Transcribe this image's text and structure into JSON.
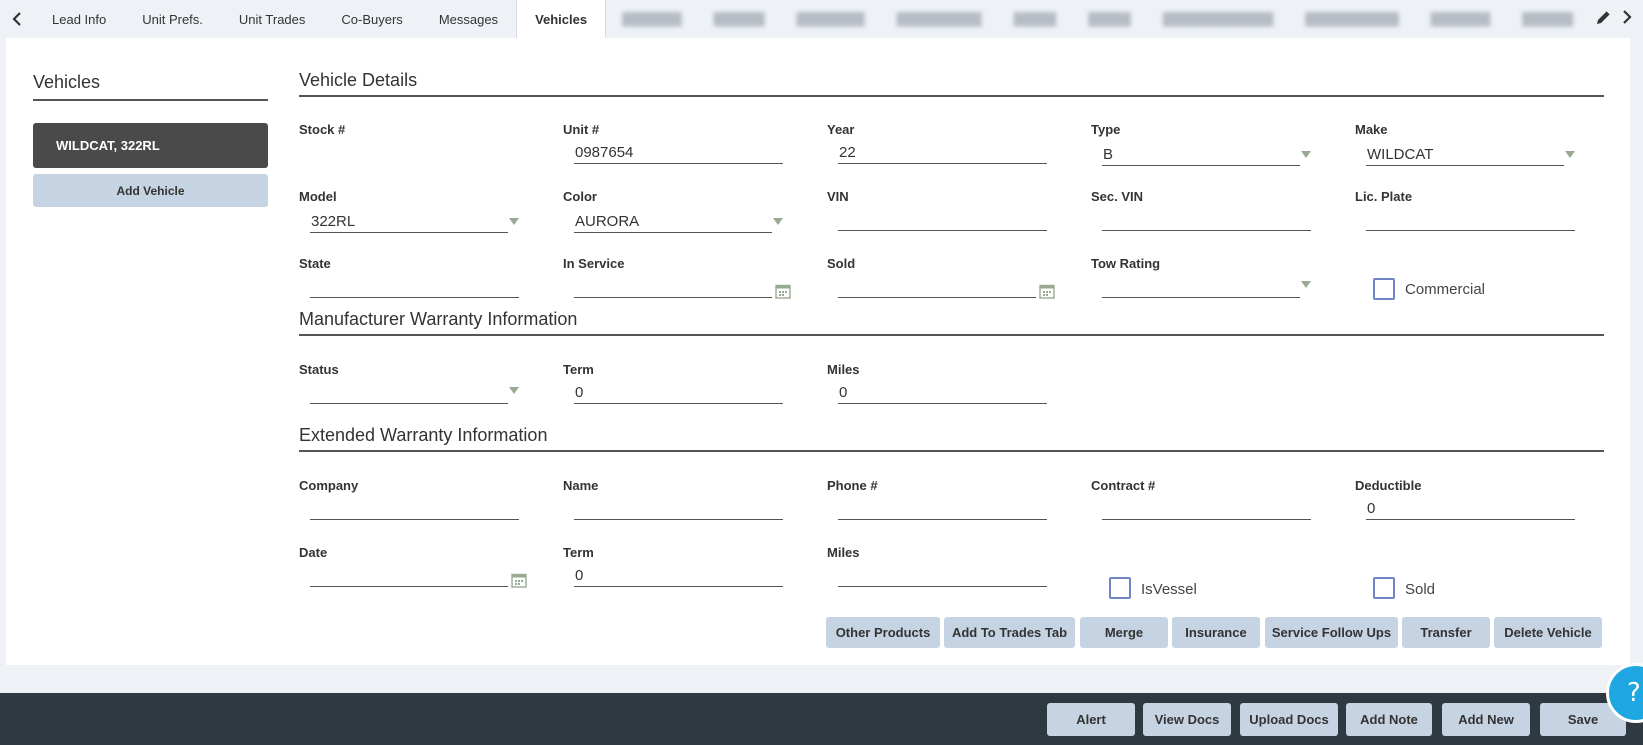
{
  "tabs": [
    {
      "label": "Lead Info"
    },
    {
      "label": "Unit Prefs."
    },
    {
      "label": "Unit Trades"
    },
    {
      "label": "Co-Buyers"
    },
    {
      "label": "Messages"
    },
    {
      "label": "Vehicles"
    }
  ],
  "active_tab": "Vehicles",
  "left": {
    "title": "Vehicles",
    "vehicle_item": "WILDCAT, 322RL",
    "add_vehicle": "Add Vehicle"
  },
  "details": {
    "title": "Vehicle Details",
    "stock_label": "Stock #",
    "stock_value": "",
    "unit_label": "Unit #",
    "unit_value": "0987654",
    "year_label": "Year",
    "year_value": "22",
    "type_label": "Type",
    "type_value": "B",
    "make_label": "Make",
    "make_value": "WILDCAT",
    "model_label": "Model",
    "model_value": "322RL",
    "color_label": "Color",
    "color_value": "AURORA",
    "vin_label": "VIN",
    "vin_value": "",
    "secvin_label": "Sec. VIN",
    "secvin_value": "",
    "plate_label": "Lic. Plate",
    "plate_value": "",
    "state_label": "State",
    "state_value": "",
    "inservice_label": "In Service",
    "inservice_value": "",
    "sold_label": "Sold",
    "sold_value": "",
    "tow_label": "Tow Rating",
    "tow_value": "",
    "commercial_label": "Commercial"
  },
  "mfr_warranty": {
    "title": "Manufacturer Warranty Information",
    "status_label": "Status",
    "status_value": "",
    "term_label": "Term",
    "term_value": "0",
    "miles_label": "Miles",
    "miles_value": "0"
  },
  "ext_warranty": {
    "title": "Extended Warranty Information",
    "company_label": "Company",
    "company_value": "",
    "name_label": "Name",
    "name_value": "",
    "phone_label": "Phone #",
    "phone_value": "",
    "contract_label": "Contract #",
    "contract_value": "",
    "deductible_label": "Deductible",
    "deductible_value": "0",
    "date_label": "Date",
    "date_value": "",
    "term_label": "Term",
    "term_value": "0",
    "miles_label": "Miles",
    "miles_value": "",
    "isvessel_label": "IsVessel",
    "sold_label": "Sold"
  },
  "actions": {
    "other_products": "Other Products",
    "add_to_trades": "Add To Trades Tab",
    "merge": "Merge",
    "insurance": "Insurance",
    "service_follow_ups": "Service Follow Ups",
    "transfer": "Transfer",
    "delete_vehicle": "Delete Vehicle"
  },
  "bottom": {
    "alert": "Alert",
    "view_docs": "View Docs",
    "upload_docs": "Upload Docs",
    "add_note": "Add Note",
    "add_new": "Add New",
    "save": "Save"
  },
  "help_glyph": "?",
  "colors": {
    "active_vehicle_bg": "#4a4a4a",
    "button_bg": "#c5d3e3",
    "bottom_bar": "#2f3941",
    "help": "#1ea7e0",
    "checkbox_border": "#6e86c9"
  }
}
